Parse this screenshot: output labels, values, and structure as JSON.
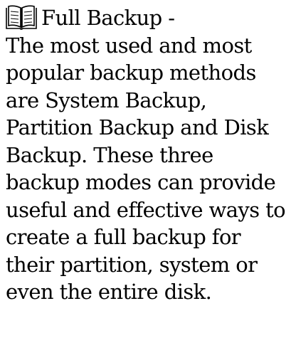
{
  "help": {
    "icon": "book-icon",
    "title": "Full Backup -",
    "lines": [
      "The most used and most",
      "popular backup methods",
      "are System Backup,",
      "Partition Backup and Disk",
      "Backup. These three",
      "backup modes can provide",
      "useful and effective ways to",
      "create a full backup for",
      "their partition, system or",
      "even the entire disk."
    ]
  }
}
